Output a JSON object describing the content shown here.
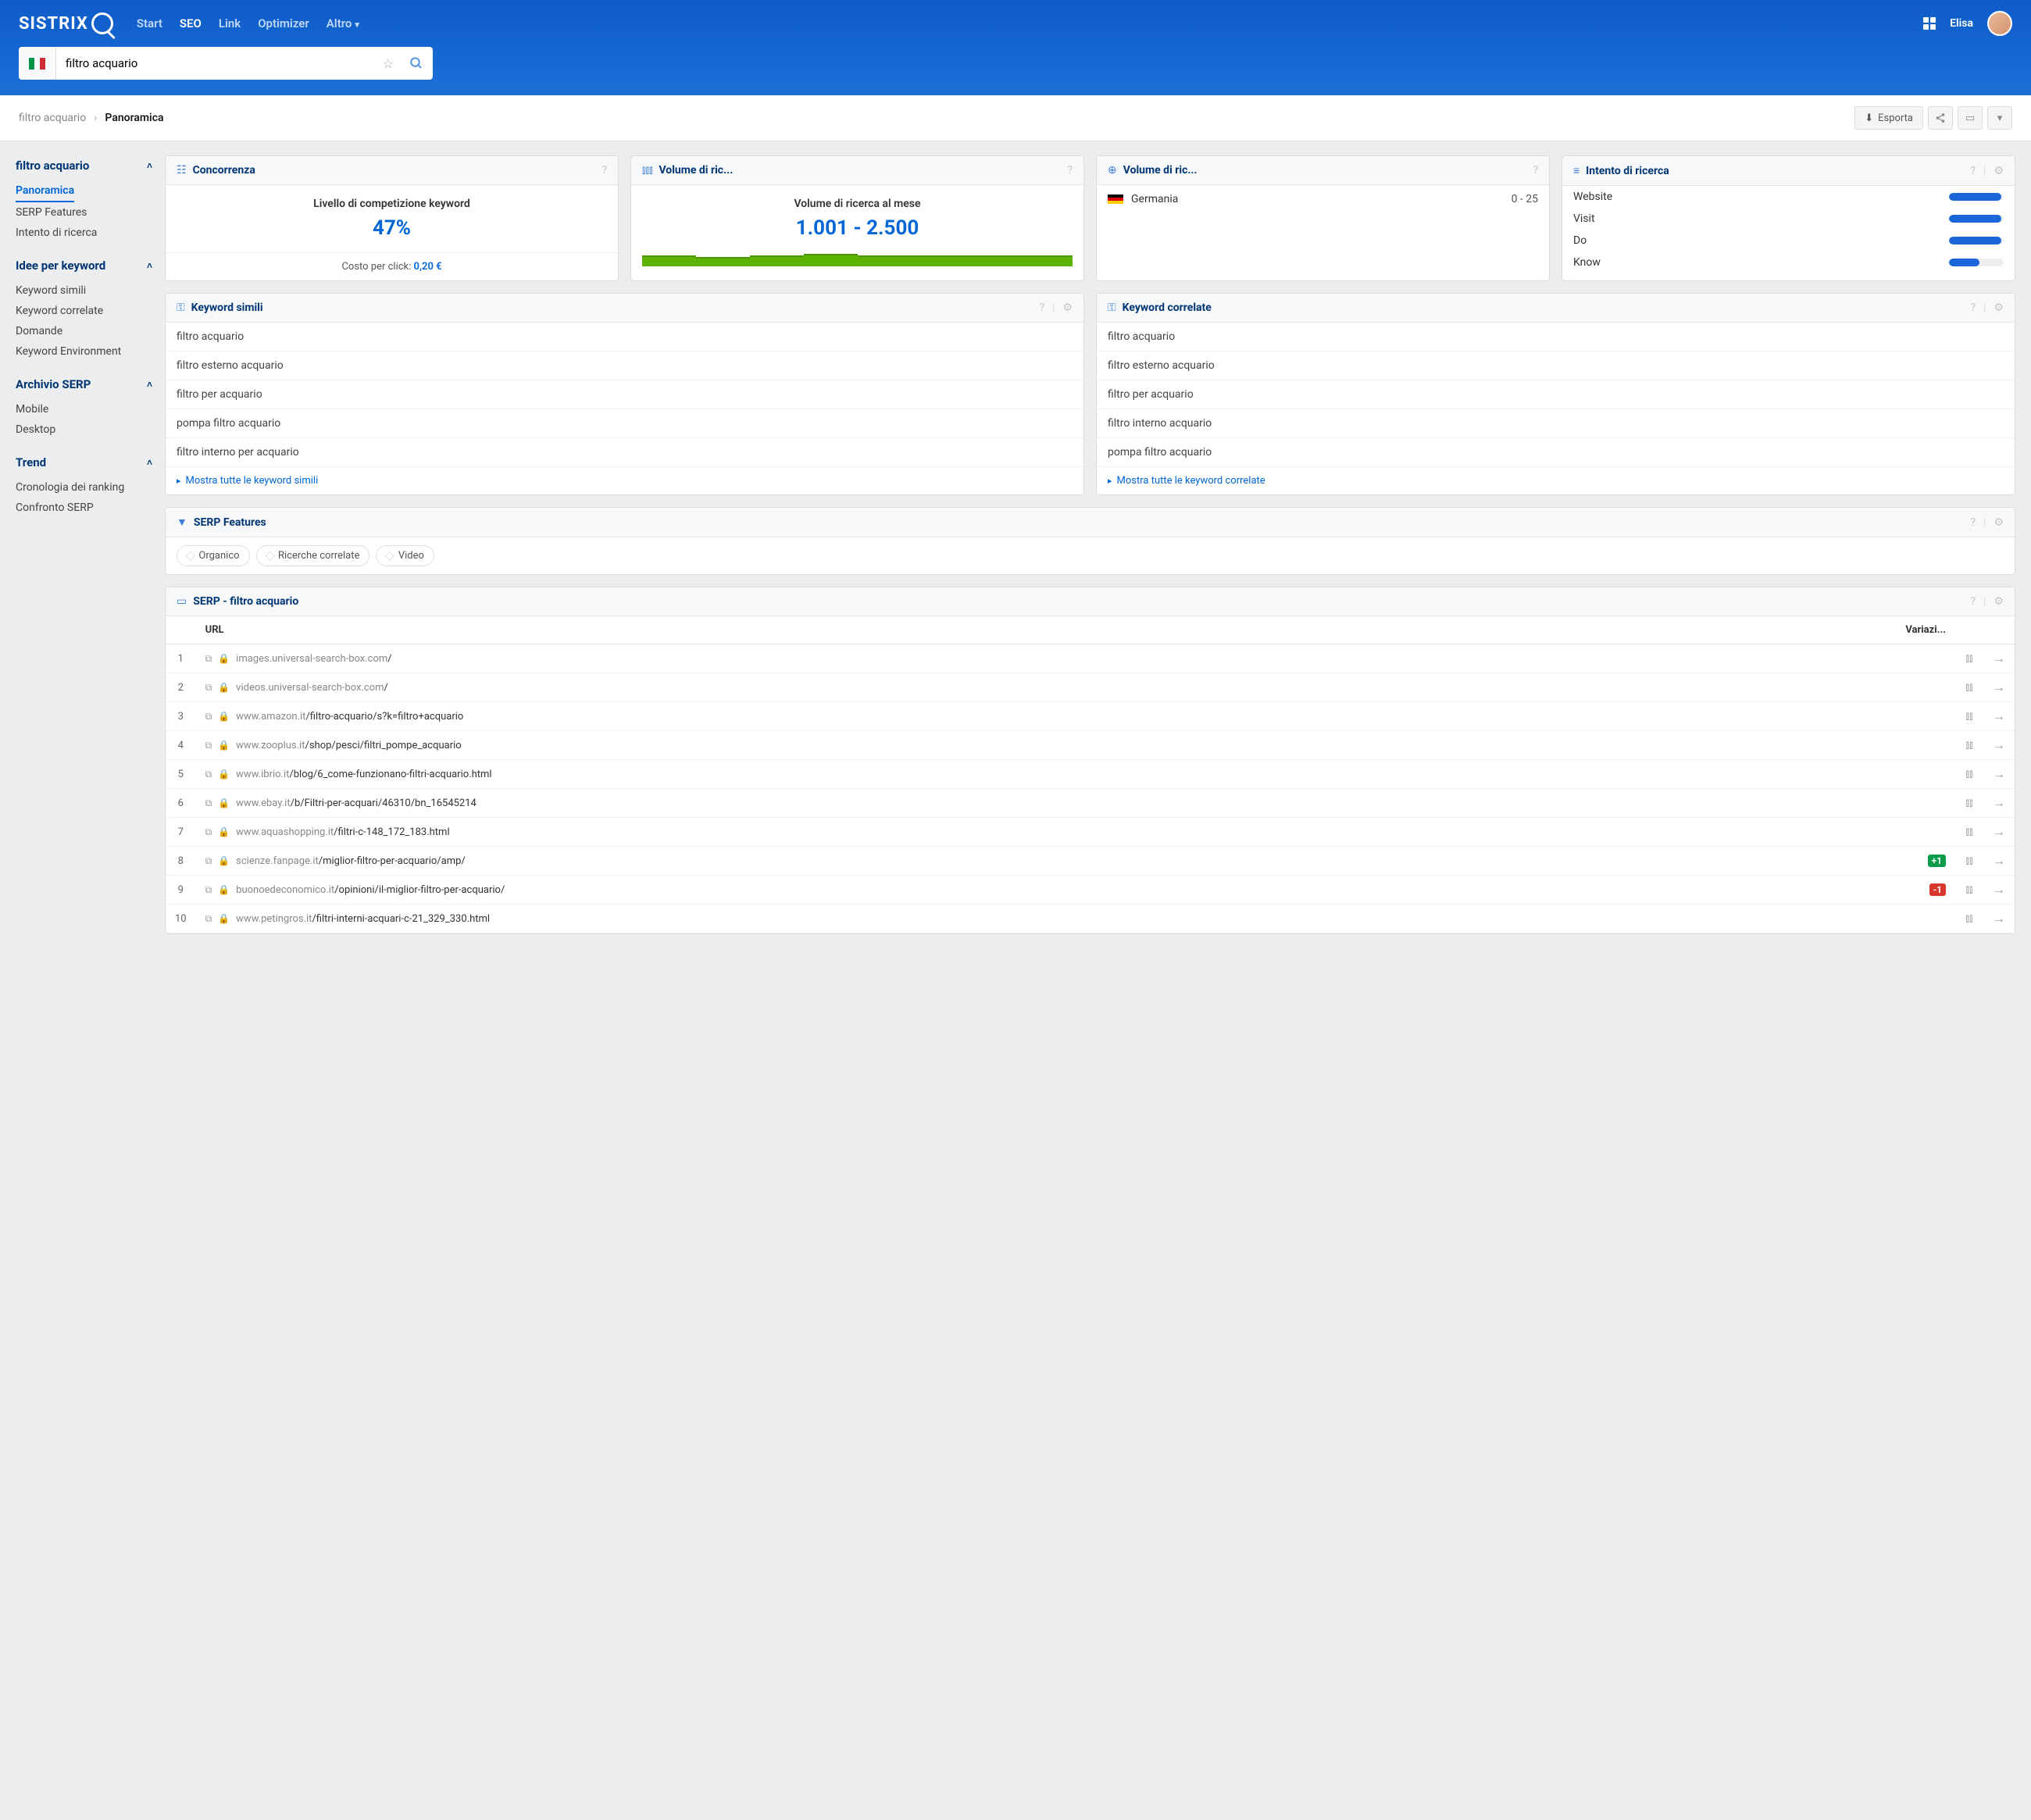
{
  "header": {
    "logo": "SISTRIX",
    "nav": {
      "start": "Start",
      "seo": "SEO",
      "link": "Link",
      "optimizer": "Optimizer",
      "altro": "Altro"
    },
    "user": "Elisa"
  },
  "search": {
    "value": "filtro acquario"
  },
  "breadcrumb": {
    "root": "filtro acquario",
    "current": "Panoramica"
  },
  "export_label": "Esporta",
  "sidebar": {
    "s1": {
      "title": "filtro acquario",
      "items": [
        "Panoramica",
        "SERP Features",
        "Intento di ricerca"
      ]
    },
    "s2": {
      "title": "Idee per keyword",
      "items": [
        "Keyword simili",
        "Keyword correlate",
        "Domande",
        "Keyword Environment"
      ]
    },
    "s3": {
      "title": "Archivio SERP",
      "items": [
        "Mobile",
        "Desktop"
      ]
    },
    "s4": {
      "title": "Trend",
      "items": [
        "Cronologia dei ranking",
        "Confronto SERP"
      ]
    }
  },
  "cards": {
    "competition": {
      "title": "Concorrenza",
      "label": "Livello di competizione keyword",
      "value": "47%",
      "cpc_label": "Costo per click:",
      "cpc": "0,20 €"
    },
    "volume": {
      "title": "Volume di ric...",
      "label": "Volume di ricerca al mese",
      "value": "1.001 - 2.500"
    },
    "volume2": {
      "title": "Volume di ric...",
      "country": "Germania",
      "range": "0 - 25"
    },
    "intent": {
      "title": "Intento di ricerca",
      "rows": [
        {
          "label": "Website",
          "pct": 95
        },
        {
          "label": "Visit",
          "pct": 95
        },
        {
          "label": "Do",
          "pct": 95
        },
        {
          "label": "Know",
          "pct": 55
        }
      ]
    },
    "similar": {
      "title": "Keyword simili",
      "items": [
        "filtro acquario",
        "filtro esterno acquario",
        "filtro per acquario",
        "pompa filtro acquario",
        "filtro interno per acquario"
      ],
      "show_all": "Mostra tutte le keyword simili"
    },
    "related": {
      "title": "Keyword correlate",
      "items": [
        "filtro acquario",
        "filtro esterno acquario",
        "filtro per acquario",
        "filtro interno acquario",
        "pompa filtro acquario"
      ],
      "show_all": "Mostra tutte le keyword correlate"
    },
    "serp_features": {
      "title": "SERP Features",
      "pills": [
        "Organico",
        "Ricerche correlate",
        "Video"
      ]
    },
    "serp": {
      "title": "SERP - filtro acquario",
      "headers": {
        "url": "URL",
        "var": "Variazi..."
      },
      "rows": [
        {
          "rank": "1",
          "domain": "images.universal-search-box.com",
          "path": "/",
          "var": ""
        },
        {
          "rank": "2",
          "domain": "videos.universal-search-box.com",
          "path": "/",
          "var": ""
        },
        {
          "rank": "3",
          "domain": "www.amazon.it",
          "path": "/filtro-acquario/s?k=filtro+acquario",
          "var": ""
        },
        {
          "rank": "4",
          "domain": "www.zooplus.it",
          "path": "/shop/pesci/filtri_pompe_acquario",
          "var": ""
        },
        {
          "rank": "5",
          "domain": "www.ibrio.it",
          "path": "/blog/6_come-funzionano-filtri-acquario.html",
          "var": ""
        },
        {
          "rank": "6",
          "domain": "www.ebay.it",
          "path": "/b/Filtri-per-acquari/46310/bn_16545214",
          "var": ""
        },
        {
          "rank": "7",
          "domain": "www.aquashopping.it",
          "path": "/filtri-c-148_172_183.html",
          "var": ""
        },
        {
          "rank": "8",
          "domain": "scienze.fanpage.it",
          "path": "/miglior-filtro-per-acquario/amp/",
          "var": "+1"
        },
        {
          "rank": "9",
          "domain": "buonoedeconomico.it",
          "path": "/opinioni/il-miglior-filtro-per-acquario/",
          "var": "-1"
        },
        {
          "rank": "10",
          "domain": "www.petingros.it",
          "path": "/filtri-interni-acquari-c-21_329_330.html",
          "var": ""
        }
      ]
    }
  }
}
